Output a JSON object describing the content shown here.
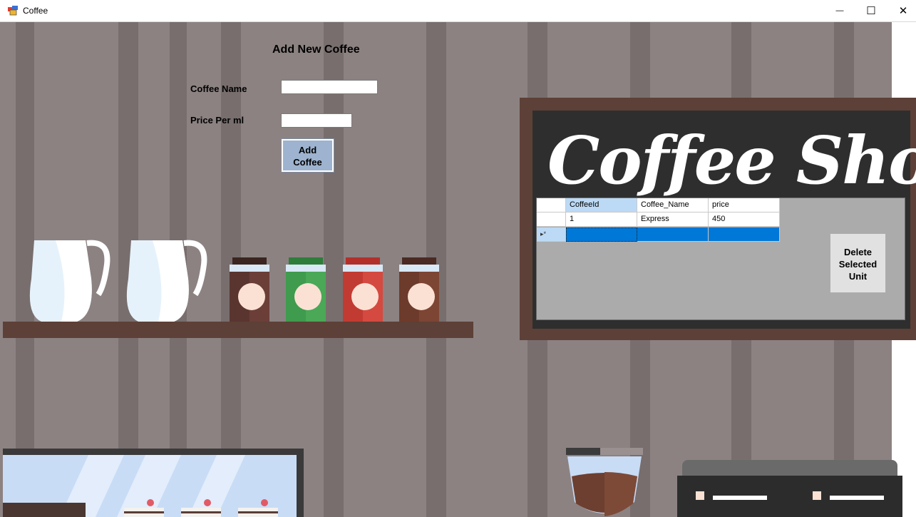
{
  "window": {
    "title": "Coffee",
    "minimize_glyph": "—",
    "maximize_glyph": "☐",
    "close_glyph": "✕"
  },
  "form": {
    "heading": "Add New Coffee",
    "coffee_name_label": "Coffee Name",
    "coffee_name_value": "",
    "price_label": "Price Per ml",
    "price_value": "",
    "add_button_line1": "Add",
    "add_button_line2": "Coffee"
  },
  "sign": {
    "title": "Coffee Shop"
  },
  "grid": {
    "columns": [
      "CoffeeId",
      "Coffee_Name",
      "price"
    ],
    "rows": [
      [
        "1",
        "Express",
        "450"
      ]
    ],
    "new_row_marker": "▸*"
  },
  "delete_button": {
    "line1": "Delete",
    "line2": "Selected",
    "line3": "Unit"
  },
  "colors": {
    "wall": "#8c8282",
    "wall_stripe": "#786e6e",
    "wood": "#5d4037",
    "board": "#2e2e2e",
    "button_blue": "#9db3cf",
    "selection": "#0078d7",
    "header_selected": "#bcdaf5"
  },
  "icons": [
    "app-icon",
    "minimize-icon",
    "maximize-icon",
    "close-icon"
  ]
}
